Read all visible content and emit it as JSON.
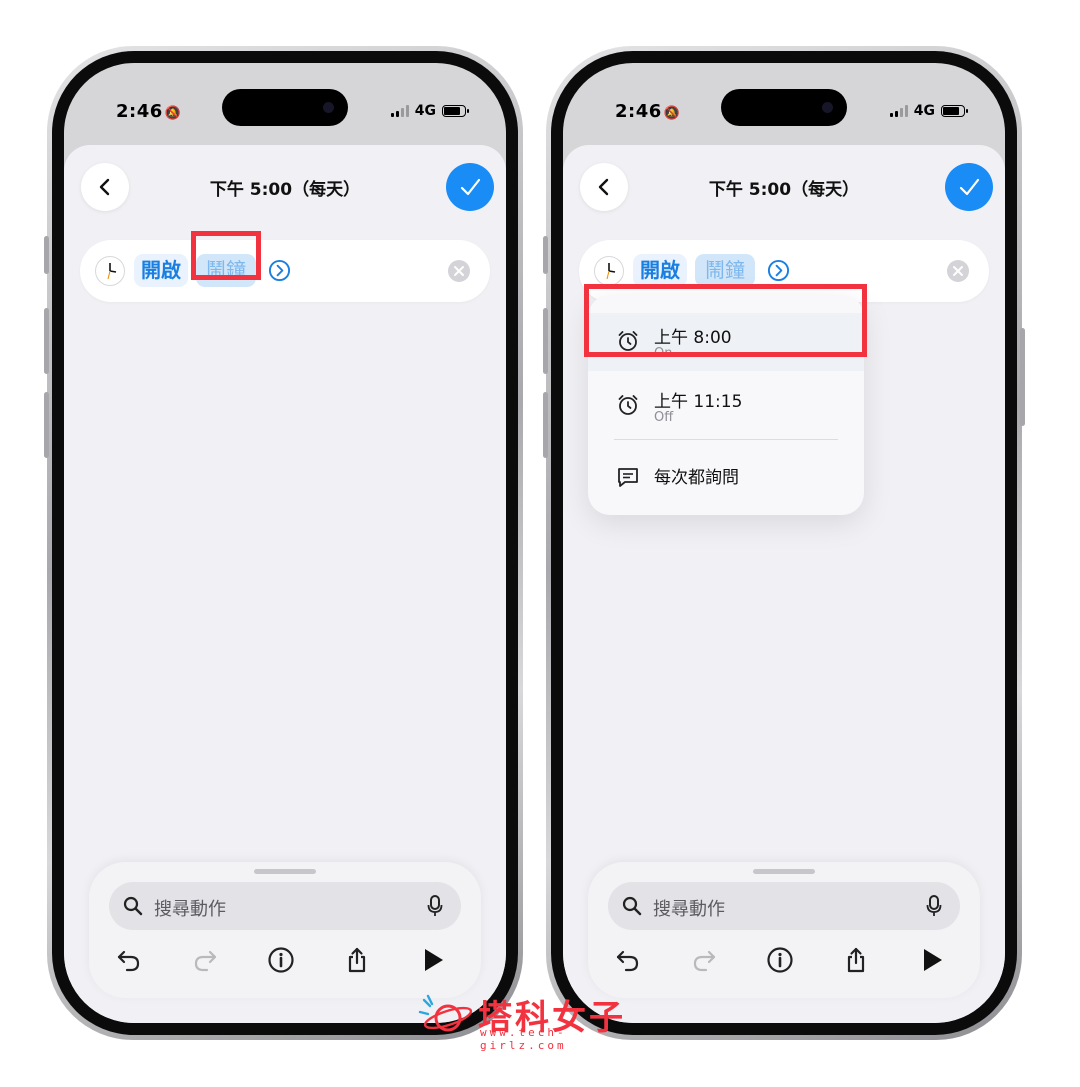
{
  "status": {
    "time": "2:46",
    "network": "4G"
  },
  "nav": {
    "title": "下午 5:00（每天）"
  },
  "action": {
    "verb": "開啟",
    "param": "鬧鐘"
  },
  "menu": {
    "items": [
      {
        "title": "上午 8:00",
        "subtitle": "On"
      },
      {
        "title": "上午 11:15",
        "subtitle": "Off"
      }
    ],
    "ask": "每次都詢問"
  },
  "search": {
    "placeholder": "搜尋動作"
  },
  "icons": [
    "back-icon",
    "checkmark-icon",
    "clock-app-icon",
    "chevron-right-circle-icon",
    "clear-icon",
    "alarm-icon",
    "message-icon",
    "search-icon",
    "mic-icon",
    "undo-icon",
    "redo-icon",
    "info-icon",
    "share-icon",
    "play-icon"
  ],
  "colors": {
    "accent": "#1a8cf5",
    "highlight": "#f2323f"
  },
  "watermark": {
    "name": "塔科女子",
    "url": "www.tech-girlz.com"
  }
}
